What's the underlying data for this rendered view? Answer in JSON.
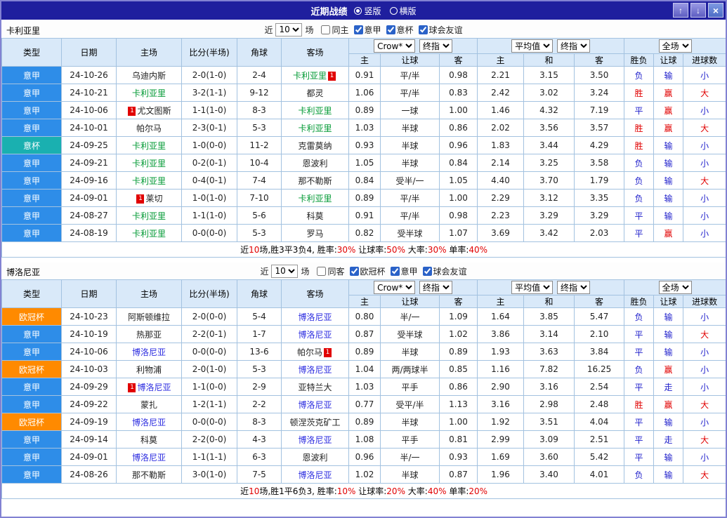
{
  "titlebar": {
    "title": "近期战绩",
    "radios": [
      {
        "label": "竖版",
        "selected": true
      },
      {
        "label": "横版",
        "selected": false
      }
    ],
    "buttons": {
      "up": "↑",
      "down": "↓",
      "close": "×"
    }
  },
  "columns": {
    "type": "类型",
    "date": "日期",
    "home": "主场",
    "score": "比分(半场)",
    "corner": "角球",
    "away": "客场",
    "h": "主",
    "handicap": "让球",
    "a": "客",
    "avg_h": "主",
    "avg_d": "和",
    "avg_a": "客",
    "result": "胜负",
    "let": "让球",
    "goals": "进球数"
  },
  "dropdowns": {
    "bookmaker": "Crow*",
    "final_a": "终指",
    "average": "平均值",
    "final_b": "终指",
    "scope": "全场"
  },
  "tables": [
    {
      "team": "卡利亚里",
      "controls": {
        "near": "近",
        "count": "10",
        "games": "场",
        "checks": [
          {
            "label": "同主",
            "on": false
          },
          {
            "label": "意甲",
            "on": true
          },
          {
            "label": "意杯",
            "on": true
          },
          {
            "label": "球会友谊",
            "on": true
          }
        ]
      },
      "rows": [
        {
          "lg": "意甲",
          "lgc": "blue",
          "date": "24-10-26",
          "home": {
            "n": "乌迪内斯"
          },
          "score": "2-0(1-0)",
          "cor": "2-4",
          "away": {
            "n": "卡利亚里",
            "c": "green",
            "ca": "1"
          },
          "o": [
            "0.91",
            "平/半",
            "0.98",
            "2.21",
            "3.15",
            "3.50"
          ],
          "res": [
            "负",
            "b"
          ],
          "hcp": [
            "输",
            "b"
          ],
          "gl": [
            "小",
            "b"
          ]
        },
        {
          "lg": "意甲",
          "lgc": "blue",
          "date": "24-10-21",
          "home": {
            "n": "卡利亚里",
            "c": "green"
          },
          "score": "3-2(1-1)",
          "cor": "9-12",
          "away": {
            "n": "都灵"
          },
          "o": [
            "1.06",
            "平/半",
            "0.83",
            "2.42",
            "3.02",
            "3.24"
          ],
          "res": [
            "胜",
            "r"
          ],
          "hcp": [
            "赢",
            "r"
          ],
          "gl": [
            "大",
            "r"
          ]
        },
        {
          "lg": "意甲",
          "lgc": "blue",
          "date": "24-10-06",
          "home": {
            "n": "尤文图斯",
            "cb": "1"
          },
          "score": "1-1(1-0)",
          "cor": "8-3",
          "away": {
            "n": "卡利亚里",
            "c": "green"
          },
          "o": [
            "0.89",
            "一球",
            "1.00",
            "1.46",
            "4.32",
            "7.19"
          ],
          "res": [
            "平",
            "b"
          ],
          "hcp": [
            "赢",
            "r"
          ],
          "gl": [
            "小",
            "b"
          ]
        },
        {
          "lg": "意甲",
          "lgc": "blue",
          "date": "24-10-01",
          "home": {
            "n": "帕尔马"
          },
          "score": "2-3(0-1)",
          "cor": "5-3",
          "away": {
            "n": "卡利亚里",
            "c": "green"
          },
          "o": [
            "1.03",
            "半球",
            "0.86",
            "2.02",
            "3.56",
            "3.57"
          ],
          "res": [
            "胜",
            "r"
          ],
          "hcp": [
            "赢",
            "r"
          ],
          "gl": [
            "大",
            "r"
          ]
        },
        {
          "lg": "意杯",
          "lgc": "teal",
          "date": "24-09-25",
          "home": {
            "n": "卡利亚里",
            "c": "green"
          },
          "score": "1-0(0-0)",
          "cor": "11-2",
          "away": {
            "n": "克雷莫纳"
          },
          "o": [
            "0.93",
            "半球",
            "0.96",
            "1.83",
            "3.44",
            "4.29"
          ],
          "res": [
            "胜",
            "r"
          ],
          "hcp": [
            "输",
            "b"
          ],
          "gl": [
            "小",
            "b"
          ]
        },
        {
          "lg": "意甲",
          "lgc": "blue",
          "date": "24-09-21",
          "home": {
            "n": "卡利亚里",
            "c": "green"
          },
          "score": "0-2(0-1)",
          "cor": "10-4",
          "away": {
            "n": "恩波利"
          },
          "o": [
            "1.05",
            "半球",
            "0.84",
            "2.14",
            "3.25",
            "3.58"
          ],
          "res": [
            "负",
            "b"
          ],
          "hcp": [
            "输",
            "b"
          ],
          "gl": [
            "小",
            "b"
          ]
        },
        {
          "lg": "意甲",
          "lgc": "blue",
          "date": "24-09-16",
          "home": {
            "n": "卡利亚里",
            "c": "green"
          },
          "score": "0-4(0-1)",
          "cor": "7-4",
          "away": {
            "n": "那不勒斯"
          },
          "o": [
            "0.84",
            "受半/一",
            "1.05",
            "4.40",
            "3.70",
            "1.79"
          ],
          "res": [
            "负",
            "b"
          ],
          "hcp": [
            "输",
            "b"
          ],
          "gl": [
            "大",
            "r"
          ]
        },
        {
          "lg": "意甲",
          "lgc": "blue",
          "date": "24-09-01",
          "home": {
            "n": "莱切",
            "cb": "1"
          },
          "score": "1-0(1-0)",
          "cor": "7-10",
          "away": {
            "n": "卡利亚里",
            "c": "green"
          },
          "o": [
            "0.89",
            "平/半",
            "1.00",
            "2.29",
            "3.12",
            "3.35"
          ],
          "res": [
            "负",
            "b"
          ],
          "hcp": [
            "输",
            "b"
          ],
          "gl": [
            "小",
            "b"
          ]
        },
        {
          "lg": "意甲",
          "lgc": "blue",
          "date": "24-08-27",
          "home": {
            "n": "卡利亚里",
            "c": "green"
          },
          "score": "1-1(1-0)",
          "cor": "5-6",
          "away": {
            "n": "科莫"
          },
          "o": [
            "0.91",
            "平/半",
            "0.98",
            "2.23",
            "3.29",
            "3.29"
          ],
          "res": [
            "平",
            "b"
          ],
          "hcp": [
            "输",
            "b"
          ],
          "gl": [
            "小",
            "b"
          ]
        },
        {
          "lg": "意甲",
          "lgc": "blue",
          "date": "24-08-19",
          "home": {
            "n": "卡利亚里",
            "c": "green"
          },
          "score": "0-0(0-0)",
          "cor": "5-3",
          "away": {
            "n": "罗马"
          },
          "o": [
            "0.82",
            "受半球",
            "1.07",
            "3.69",
            "3.42",
            "2.03"
          ],
          "res": [
            "平",
            "b"
          ],
          "hcp": [
            "赢",
            "r"
          ],
          "gl": [
            "小",
            "b"
          ]
        }
      ],
      "footer": [
        {
          "t": "近"
        },
        {
          "t": "10",
          "r": 1
        },
        {
          "t": "场,胜3平3负4, 胜率:"
        },
        {
          "t": "30%",
          "r": 1
        },
        {
          "t": " 让球率:"
        },
        {
          "t": "50%",
          "r": 1
        },
        {
          "t": " 大率:"
        },
        {
          "t": "30%",
          "r": 1
        },
        {
          "t": " 单率:"
        },
        {
          "t": "40%",
          "r": 1
        }
      ]
    },
    {
      "team": "博洛尼亚",
      "controls": {
        "near": "近",
        "count": "10",
        "games": "场",
        "checks": [
          {
            "label": "同客",
            "on": false
          },
          {
            "label": "欧冠杯",
            "on": true
          },
          {
            "label": "意甲",
            "on": true
          },
          {
            "label": "球会友谊",
            "on": true
          }
        ]
      },
      "rows": [
        {
          "lg": "欧冠杯",
          "lgc": "orange",
          "date": "24-10-23",
          "home": {
            "n": "阿斯顿维拉"
          },
          "score": "2-0(0-0)",
          "cor": "5-4",
          "away": {
            "n": "博洛尼亚",
            "c": "blue"
          },
          "o": [
            "0.80",
            "半/一",
            "1.09",
            "1.64",
            "3.85",
            "5.47"
          ],
          "res": [
            "负",
            "b"
          ],
          "hcp": [
            "输",
            "b"
          ],
          "gl": [
            "小",
            "b"
          ]
        },
        {
          "lg": "意甲",
          "lgc": "blue",
          "date": "24-10-19",
          "home": {
            "n": "热那亚"
          },
          "score": "2-2(0-1)",
          "cor": "1-7",
          "away": {
            "n": "博洛尼亚",
            "c": "blue"
          },
          "o": [
            "0.87",
            "受半球",
            "1.02",
            "3.86",
            "3.14",
            "2.10"
          ],
          "res": [
            "平",
            "b"
          ],
          "hcp": [
            "输",
            "b"
          ],
          "gl": [
            "大",
            "r"
          ]
        },
        {
          "lg": "意甲",
          "lgc": "blue",
          "date": "24-10-06",
          "home": {
            "n": "博洛尼亚",
            "c": "blue"
          },
          "score": "0-0(0-0)",
          "cor": "13-6",
          "away": {
            "n": "帕尔马",
            "ca": "1"
          },
          "o": [
            "0.89",
            "半球",
            "0.89",
            "1.93",
            "3.63",
            "3.84"
          ],
          "res": [
            "平",
            "b"
          ],
          "hcp": [
            "输",
            "b"
          ],
          "gl": [
            "小",
            "b"
          ]
        },
        {
          "lg": "欧冠杯",
          "lgc": "orange",
          "date": "24-10-03",
          "home": {
            "n": "利物浦"
          },
          "score": "2-0(1-0)",
          "cor": "5-3",
          "away": {
            "n": "博洛尼亚",
            "c": "blue"
          },
          "o": [
            "1.04",
            "两/两球半",
            "0.85",
            "1.16",
            "7.82",
            "16.25"
          ],
          "res": [
            "负",
            "b"
          ],
          "hcp": [
            "赢",
            "r"
          ],
          "gl": [
            "小",
            "b"
          ]
        },
        {
          "lg": "意甲",
          "lgc": "blue",
          "date": "24-09-29",
          "home": {
            "n": "博洛尼亚",
            "c": "blue",
            "cb": "1"
          },
          "score": "1-1(0-0)",
          "cor": "2-9",
          "away": {
            "n": "亚特兰大"
          },
          "o": [
            "1.03",
            "平手",
            "0.86",
            "2.90",
            "3.16",
            "2.54"
          ],
          "res": [
            "平",
            "b"
          ],
          "hcp": [
            "走",
            "b"
          ],
          "gl": [
            "小",
            "b"
          ]
        },
        {
          "lg": "意甲",
          "lgc": "blue",
          "date": "24-09-22",
          "home": {
            "n": "蒙扎"
          },
          "score": "1-2(1-1)",
          "cor": "2-2",
          "away": {
            "n": "博洛尼亚",
            "c": "blue"
          },
          "o": [
            "0.77",
            "受平/半",
            "1.13",
            "3.16",
            "2.98",
            "2.48"
          ],
          "res": [
            "胜",
            "r"
          ],
          "hcp": [
            "赢",
            "r"
          ],
          "gl": [
            "大",
            "r"
          ]
        },
        {
          "lg": "欧冠杯",
          "lgc": "orange",
          "date": "24-09-19",
          "home": {
            "n": "博洛尼亚",
            "c": "blue"
          },
          "score": "0-0(0-0)",
          "cor": "8-3",
          "away": {
            "n": "顿涅茨克矿工"
          },
          "o": [
            "0.89",
            "半球",
            "1.00",
            "1.92",
            "3.51",
            "4.04"
          ],
          "res": [
            "平",
            "b"
          ],
          "hcp": [
            "输",
            "b"
          ],
          "gl": [
            "小",
            "b"
          ]
        },
        {
          "lg": "意甲",
          "lgc": "blue",
          "date": "24-09-14",
          "home": {
            "n": "科莫"
          },
          "score": "2-2(0-0)",
          "cor": "4-3",
          "away": {
            "n": "博洛尼亚",
            "c": "blue"
          },
          "o": [
            "1.08",
            "平手",
            "0.81",
            "2.99",
            "3.09",
            "2.51"
          ],
          "res": [
            "平",
            "b"
          ],
          "hcp": [
            "走",
            "b"
          ],
          "gl": [
            "大",
            "r"
          ]
        },
        {
          "lg": "意甲",
          "lgc": "blue",
          "date": "24-09-01",
          "home": {
            "n": "博洛尼亚",
            "c": "blue"
          },
          "score": "1-1(1-1)",
          "cor": "6-3",
          "away": {
            "n": "恩波利"
          },
          "o": [
            "0.96",
            "半/一",
            "0.93",
            "1.69",
            "3.60",
            "5.42"
          ],
          "res": [
            "平",
            "b"
          ],
          "hcp": [
            "输",
            "b"
          ],
          "gl": [
            "小",
            "b"
          ]
        },
        {
          "lg": "意甲",
          "lgc": "blue",
          "date": "24-08-26",
          "home": {
            "n": "那不勒斯"
          },
          "score": "3-0(1-0)",
          "cor": "7-5",
          "away": {
            "n": "博洛尼亚",
            "c": "blue"
          },
          "o": [
            "1.02",
            "半球",
            "0.87",
            "1.96",
            "3.40",
            "4.01"
          ],
          "res": [
            "负",
            "b"
          ],
          "hcp": [
            "输",
            "b"
          ],
          "gl": [
            "大",
            "r"
          ]
        }
      ],
      "footer": [
        {
          "t": "近"
        },
        {
          "t": "10",
          "r": 1
        },
        {
          "t": "场,胜1平6负3, 胜率:"
        },
        {
          "t": "10%",
          "r": 1
        },
        {
          "t": " 让球率:"
        },
        {
          "t": "20%",
          "r": 1
        },
        {
          "t": " 大率:"
        },
        {
          "t": "40%",
          "r": 1
        },
        {
          "t": " 单率:"
        },
        {
          "t": "20%",
          "r": 1
        }
      ]
    }
  ]
}
